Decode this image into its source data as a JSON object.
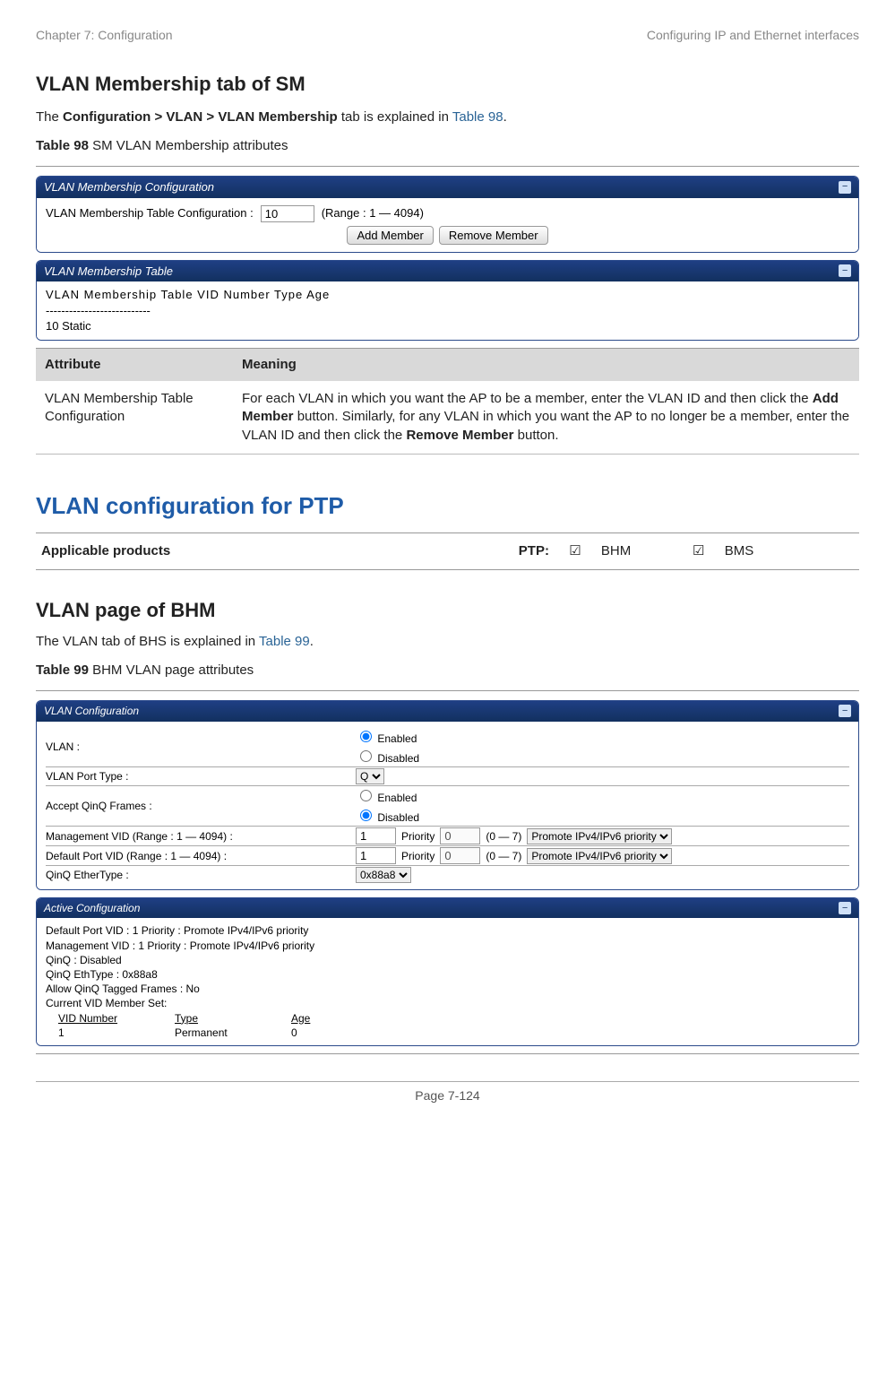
{
  "header": {
    "left": "Chapter 7:  Configuration",
    "right": "Configuring IP and Ethernet interfaces"
  },
  "section1": {
    "title": "VLAN Membership tab of SM",
    "intro_prefix": "The ",
    "intro_bold": "Configuration > VLAN > VLAN Membership",
    "intro_mid": " tab is explained in ",
    "intro_link": "Table 98",
    "intro_suffix": ".",
    "table_caption_bold": "Table 98",
    "table_caption_rest": " SM VLAN Membership attributes"
  },
  "panel_conf": {
    "title": "VLAN Membership Configuration",
    "row_label": "VLAN Membership Table Configuration :",
    "input_value": "10",
    "range_text": "(Range : 1 — 4094)",
    "btn_add": "Add Member",
    "btn_remove": "Remove Member"
  },
  "panel_table": {
    "title": "VLAN Membership Table",
    "cols": "VLAN Membership Table VID Number   Type   Age",
    "dashes": "---------------------------",
    "row": "10     Static"
  },
  "attr_table": {
    "h1": "Attribute",
    "h2": "Meaning",
    "r1c1": "VLAN Membership Table Configuration",
    "r1c2_pre": "For each VLAN in which you want the AP to be a member, enter the VLAN ID and then click the ",
    "r1c2_b1": "Add Member",
    "r1c2_mid": " button. Similarly, for any VLAN in which you want the AP to no longer be a member, enter the VLAN ID and then click the ",
    "r1c2_b2": "Remove Member",
    "r1c2_suf": " button."
  },
  "section2": {
    "title": "VLAN configuration for PTP",
    "app_label": "Applicable products",
    "ptp": "PTP:",
    "bhm": "BHM",
    "bms": "BMS",
    "check": "☑"
  },
  "section3": {
    "title": "VLAN page of BHM",
    "intro_pre": "The VLAN tab of BHS is explained in ",
    "intro_link": "Table 99",
    "intro_suf": ".",
    "caption_bold": "Table 99",
    "caption_rest": " BHM VLAN page attributes"
  },
  "vlan_cfg": {
    "title": "VLAN Configuration",
    "vlan_label": "VLAN :",
    "enabled": "Enabled",
    "disabled": "Disabled",
    "port_type_label": "VLAN Port Type :",
    "port_type_value": "Q",
    "accept_qinq_label": "Accept QinQ Frames :",
    "mvid_label": "Management VID (Range : 1 — 4094) :",
    "dpvid_label": "Default Port VID (Range : 1 — 4094) :",
    "one": "1",
    "priority": "Priority",
    "zero": "0",
    "range07": "(0 — 7)",
    "promote": "Promote IPv4/IPv6 priority",
    "qinq_ether_label": "QinQ EtherType :",
    "qinq_ether_value": "0x88a8"
  },
  "active_cfg": {
    "title": "Active Configuration",
    "l1": "Default Port VID : 1    Priority : Promote IPv4/IPv6 priority",
    "l2": "Management VID : 1    Priority : Promote IPv4/IPv6 priority",
    "l3": "QinQ : Disabled",
    "l4": "QinQ EthType : 0x88a8",
    "l5": "Allow QinQ Tagged Frames : No",
    "l6": "Current VID Member Set:",
    "th1": "VID Number",
    "th2": "Type",
    "th3": "Age",
    "r1": "1",
    "r2": "Permanent",
    "r3": "0"
  },
  "footer": "Page 7-124"
}
